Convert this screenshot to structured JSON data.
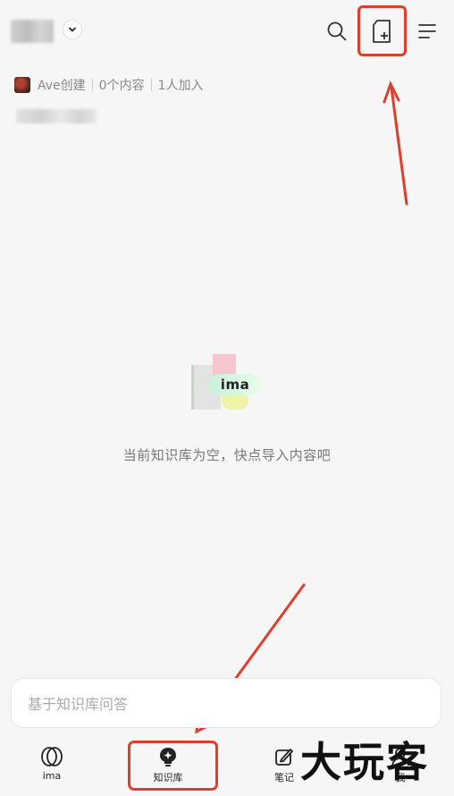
{
  "header": {
    "dropdown_icon": "chevron-down-icon",
    "search_icon": "search-icon",
    "import_icon": "file-add-icon",
    "menu_icon": "menu-icon"
  },
  "meta": {
    "creator": "Ave创建",
    "content_count": "0个内容",
    "member_count": "1人加入"
  },
  "empty_state": {
    "logo_text": "ima",
    "message": "当前知识库为空，快点导入内容吧"
  },
  "ask": {
    "placeholder": "基于知识库问答"
  },
  "nav": {
    "items": [
      {
        "label": "ima",
        "icon": "ima-logo-icon"
      },
      {
        "label": "知识库",
        "icon": "knowledge-base-icon"
      },
      {
        "label": "笔记",
        "icon": "note-edit-icon"
      },
      {
        "label": "我",
        "icon": "profile-icon"
      }
    ]
  },
  "watermark": "大玩客",
  "colors": {
    "accent": "#e03e2d",
    "background": "#f6f6f6"
  }
}
